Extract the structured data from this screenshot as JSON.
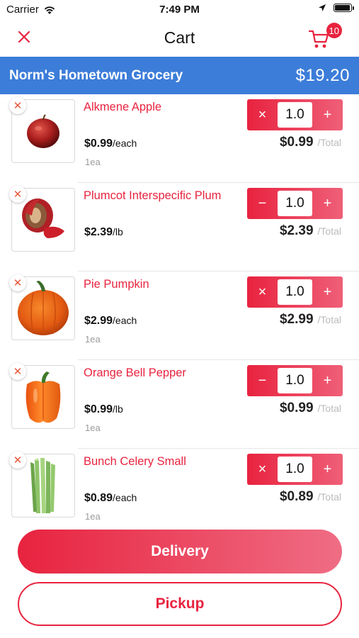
{
  "status_bar": {
    "carrier": "Carrier",
    "time": "7:49 PM",
    "battery_level": 0.95
  },
  "nav": {
    "title": "Cart",
    "cart_count": "10"
  },
  "store": {
    "name": "Norm's Hometown Grocery",
    "total": "$19.20"
  },
  "items": [
    {
      "name": "Alkmene Apple",
      "price": "$0.99",
      "unit": "/each",
      "qty_note": "1ea",
      "quantity": "1.0",
      "minus_symbol": "×",
      "plus_symbol": "+",
      "line_total": "$0.99",
      "total_label": "/Total",
      "image_icon": "apple-image"
    },
    {
      "name": "Plumcot Interspecific Plum",
      "price": "$2.39",
      "unit": "/lb",
      "qty_note": "",
      "quantity": "1.0",
      "minus_symbol": "−",
      "plus_symbol": "+",
      "line_total": "$2.39",
      "total_label": "/Total",
      "image_icon": "plum-image"
    },
    {
      "name": "Pie Pumpkin",
      "price": "$2.99",
      "unit": "/each",
      "qty_note": "1ea",
      "quantity": "1.0",
      "minus_symbol": "×",
      "plus_symbol": "+",
      "line_total": "$2.99",
      "total_label": "/Total",
      "image_icon": "pumpkin-image"
    },
    {
      "name": "Orange Bell Pepper",
      "price": "$0.99",
      "unit": "/lb",
      "qty_note": "1ea",
      "quantity": "1.0",
      "minus_symbol": "−",
      "plus_symbol": "+",
      "line_total": "$0.99",
      "total_label": "/Total",
      "image_icon": "pepper-image"
    },
    {
      "name": "Bunch Celery Small",
      "price": "$0.89",
      "unit": "/each",
      "qty_note": "1ea",
      "quantity": "1.0",
      "minus_symbol": "×",
      "plus_symbol": "+",
      "line_total": "$0.89",
      "total_label": "/Total",
      "image_icon": "celery-image"
    }
  ],
  "actions": {
    "delivery_label": "Delivery",
    "pickup_label": "Pickup"
  },
  "colors": {
    "accent": "#e8233f",
    "store_header": "#3c7dd9",
    "muted": "#9a9a9a"
  }
}
